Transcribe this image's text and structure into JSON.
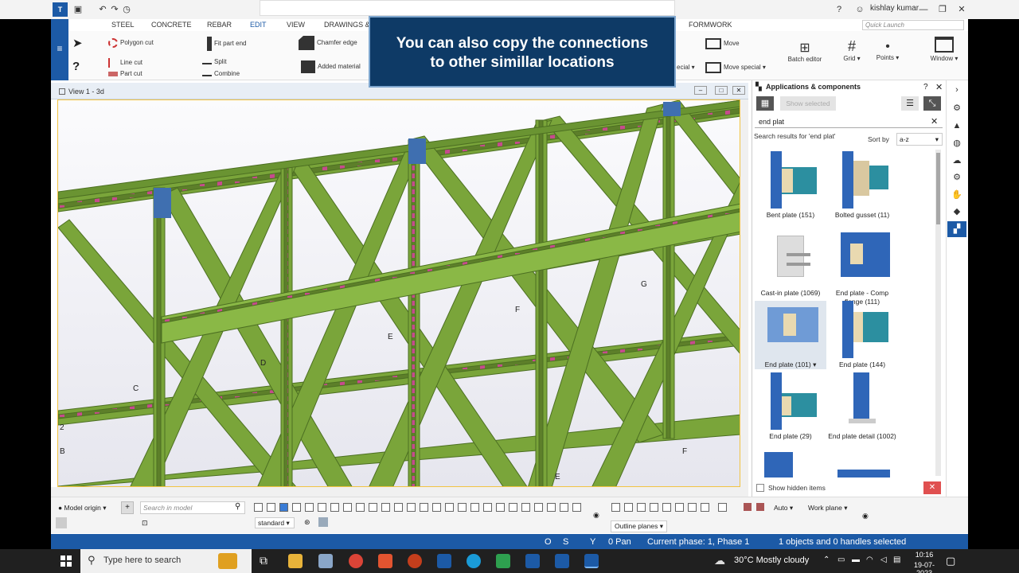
{
  "app": {
    "user_name": "kishlay kumar",
    "quick_launch_placeholder": "Quick Launch"
  },
  "ribbon_tabs": [
    "STEEL",
    "CONCRETE",
    "REBAR",
    "EDIT",
    "VIEW",
    "DRAWINGS &",
    "FORMWORK"
  ],
  "active_tab": "EDIT",
  "ribbon": {
    "polygon_cut": "Polygon cut",
    "line_cut": "Line cut",
    "part_cut": "Part cut",
    "fit_part_end": "Fit part end",
    "split": "Split",
    "combine": "Combine",
    "chamfer_edge": "Chamfer edge",
    "added_material": "Added material",
    "special_1": "ecial",
    "move": "Move",
    "move_special": "Move special",
    "batch_editor": "Batch editor",
    "grid": "Grid",
    "points": "Points",
    "window": "Window"
  },
  "banner": {
    "line1": "You can also copy the connections",
    "line2": "to other simillar locations"
  },
  "view": {
    "title": "View 1 - 3d",
    "grid_labels": [
      "C",
      "D",
      "E",
      "F",
      "G",
      "F",
      "E",
      "2",
      "B"
    ]
  },
  "panel": {
    "title": "Applications & components",
    "show_selected": "Show selected",
    "search_value": "end plat",
    "results_label": "Search results for 'end plat'",
    "sort_by": "Sort by",
    "sort_value": "a-z",
    "show_hidden": "Show hidden items",
    "components": [
      {
        "label": "Bent plate (151)"
      },
      {
        "label": "Bolted gusset (11)"
      },
      {
        "label": "Cast-in plate (1069)"
      },
      {
        "label": "End plate - Comp flange (111)"
      },
      {
        "label": "End plate (101)"
      },
      {
        "label": "End plate (144)"
      },
      {
        "label": "End plate (29)"
      },
      {
        "label": "End plate detail (1002)"
      }
    ]
  },
  "bottom": {
    "model_origin": "Model origin",
    "search_placeholder": "Search in model",
    "standard": "standard",
    "auto": "Auto",
    "work_plane": "Work plane",
    "outline_planes": "Outline planes"
  },
  "status": {
    "o": "O",
    "s": "S",
    "y": "Y",
    "pan": "0 Pan",
    "phase": "Current phase: 1, Phase 1",
    "selection": "1 objects and 0 handles selected"
  },
  "taskbar": {
    "search": "Type here to search",
    "weather": "30°C  Mostly cloudy",
    "time": "10:16",
    "date": "19-07-2023"
  },
  "colors": {
    "accent": "#1c5aa6",
    "steel_member": "#7aa53a",
    "member_edge": "#4c6f22",
    "weld_marker": "#c64b8c"
  }
}
